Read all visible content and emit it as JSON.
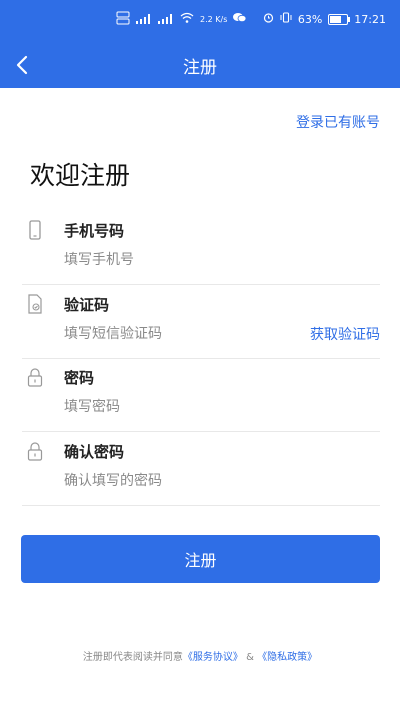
{
  "status_bar": {
    "data_speed": "2.2 K/s",
    "battery": "63%",
    "time": "17:21"
  },
  "nav": {
    "title": "注册"
  },
  "login_link": "登录已有账号",
  "welcome": "欢迎注册",
  "fields": {
    "phone": {
      "label": "手机号码",
      "placeholder": "填写手机号"
    },
    "code": {
      "label": "验证码",
      "placeholder": "填写短信验证码",
      "action": "获取验证码"
    },
    "password": {
      "label": "密码",
      "placeholder": "填写密码"
    },
    "confirm": {
      "label": "确认密码",
      "placeholder": "确认填写的密码"
    }
  },
  "submit_label": "注册",
  "agreement": {
    "prefix": "注册即代表阅读并同意",
    "service": "《服务协议》",
    "amp": " & ",
    "privacy": "《隐私政策》"
  },
  "colors": {
    "primary": "#2f6ee6",
    "background": "#ffffff",
    "divider": "#e8e8e8"
  }
}
